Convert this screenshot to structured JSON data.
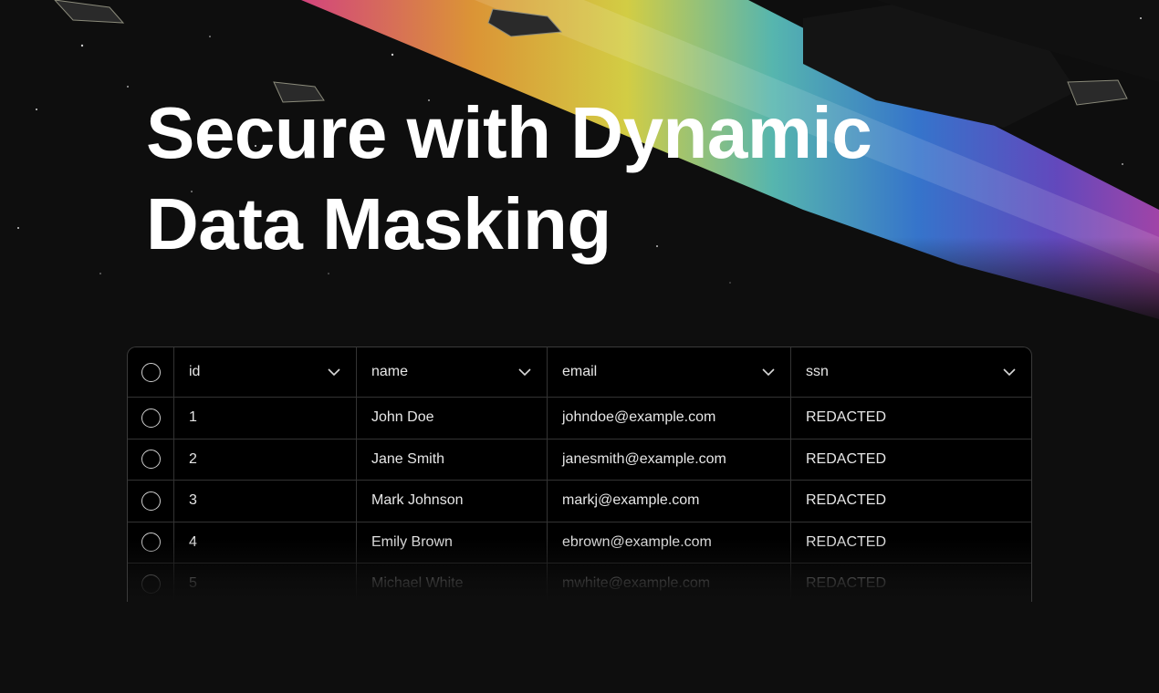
{
  "headline": {
    "line1": "Secure with Dynamic",
    "line2": "Data Masking"
  },
  "table": {
    "columns": [
      {
        "key": "id",
        "label": "id"
      },
      {
        "key": "name",
        "label": "name"
      },
      {
        "key": "email",
        "label": "email"
      },
      {
        "key": "ssn",
        "label": "ssn"
      }
    ],
    "rows": [
      {
        "id": "1",
        "name": "John Doe",
        "email": "johndoe@example.com",
        "ssn": "REDACTED"
      },
      {
        "id": "2",
        "name": "Jane Smith",
        "email": "janesmith@example.com",
        "ssn": "REDACTED"
      },
      {
        "id": "3",
        "name": "Mark Johnson",
        "email": "markj@example.com",
        "ssn": "REDACTED"
      },
      {
        "id": "4",
        "name": "Emily Brown",
        "email": "ebrown@example.com",
        "ssn": "REDACTED"
      },
      {
        "id": "5",
        "name": "Michael White",
        "email": "mwhite@example.com",
        "ssn": "REDACTED"
      }
    ]
  },
  "icons": {
    "header_checkbox": "circle-checkbox-icon",
    "row_checkbox": "circle-checkbox-icon",
    "column_menu": "chevron-down-icon"
  },
  "colors": {
    "background": "#0e0e0e",
    "table_background": "#000000",
    "border": "#333333",
    "text": "#e6e6e6",
    "headline": "#ffffff"
  }
}
